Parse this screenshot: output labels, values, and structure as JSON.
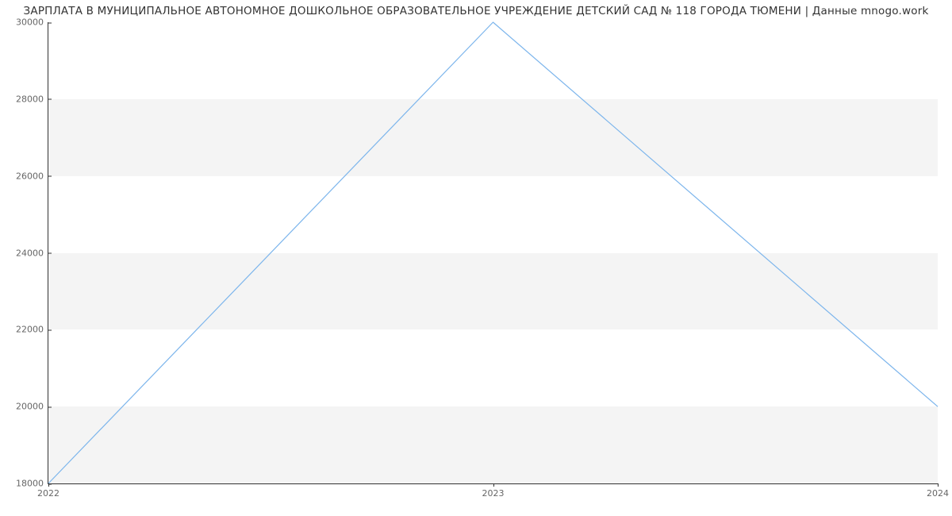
{
  "chart_data": {
    "type": "line",
    "title": "ЗАРПЛАТА В МУНИЦИПАЛЬНОЕ АВТОНОМНОЕ ДОШКОЛЬНОЕ ОБРАЗОВАТЕЛЬНОЕ УЧРЕЖДЕНИЕ ДЕТСКИЙ САД № 118 ГОРОДА ТЮМЕНИ | Данные mnogo.work",
    "xlabel": "",
    "ylabel": "",
    "x": [
      2022,
      2023,
      2024
    ],
    "values": [
      18000,
      30000,
      20000
    ],
    "x_ticks": [
      "2022",
      "2023",
      "2024"
    ],
    "y_ticks": [
      "18000",
      "20000",
      "22000",
      "24000",
      "26000",
      "28000",
      "30000"
    ],
    "xlim": [
      2022,
      2024
    ],
    "ylim": [
      18000,
      30000
    ],
    "bands": [
      [
        18000,
        20000
      ],
      [
        22000,
        24000
      ],
      [
        26000,
        28000
      ]
    ],
    "line_color": "#7cb5ec"
  }
}
